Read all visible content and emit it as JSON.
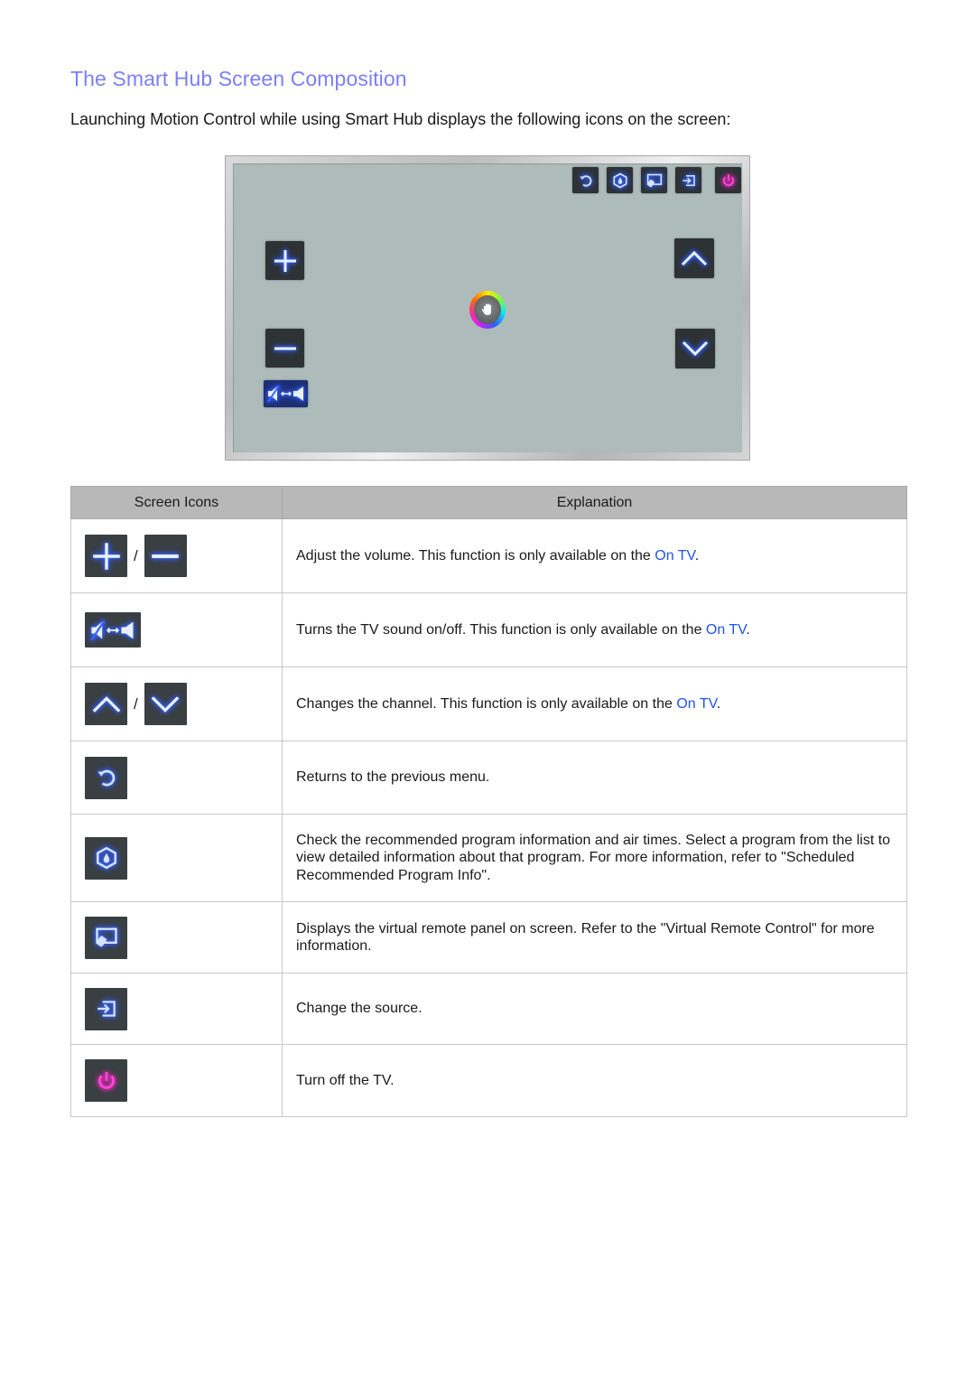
{
  "page": {
    "title": "The Smart Hub Screen Composition",
    "intro": "Launching Motion Control while using Smart Hub displays the following icons on the screen:"
  },
  "colors": {
    "title": "#7b7ff5",
    "link": "#1f55e8",
    "icon_glow_blue": "#3a6bff",
    "icon_glow_pink": "#e01fbb",
    "screen_bg": "#adbbba",
    "button_bg": "#2d3235"
  },
  "tv_screen": {
    "top_icons": [
      "return-icon",
      "recommended-icon",
      "virtual-remote-icon",
      "source-icon",
      "power-icon"
    ],
    "left_icons": [
      "volume-up-icon",
      "volume-down-icon",
      "mute-toggle-icon"
    ],
    "right_icons": [
      "channel-up-icon",
      "channel-down-icon"
    ],
    "center_icon": "hand-cursor-icon"
  },
  "table": {
    "headers": [
      "Screen Icons",
      "Explanation"
    ],
    "slash": "/",
    "rows": [
      {
        "icons": [
          "volume-up-icon",
          "volume-down-icon"
        ],
        "text_before": "Adjust the volume. This function is only available on the ",
        "link": "On TV",
        "text_after": "."
      },
      {
        "icons": [
          "mute-toggle-icon"
        ],
        "text_before": "Turns the TV sound on/off. This function is only available on the ",
        "link": "On TV",
        "text_after": "."
      },
      {
        "icons": [
          "channel-up-icon",
          "channel-down-icon"
        ],
        "text_before": "Changes the channel. This function is only available on the ",
        "link": "On TV",
        "text_after": "."
      },
      {
        "icons": [
          "return-icon"
        ],
        "text": "Returns to the previous menu."
      },
      {
        "icons": [
          "recommended-icon"
        ],
        "text": "Check the recommended program information and air times. Select a program from the list to view detailed information about that program. For more information, refer to \"Scheduled Recommended Program Info\"."
      },
      {
        "icons": [
          "virtual-remote-icon"
        ],
        "text": "Displays the virtual remote panel on screen. Refer to the \"Virtual Remote Control\" for more information."
      },
      {
        "icons": [
          "source-icon"
        ],
        "text": "Change the source."
      },
      {
        "icons": [
          "power-icon"
        ],
        "text": "Turn off the TV."
      }
    ]
  }
}
